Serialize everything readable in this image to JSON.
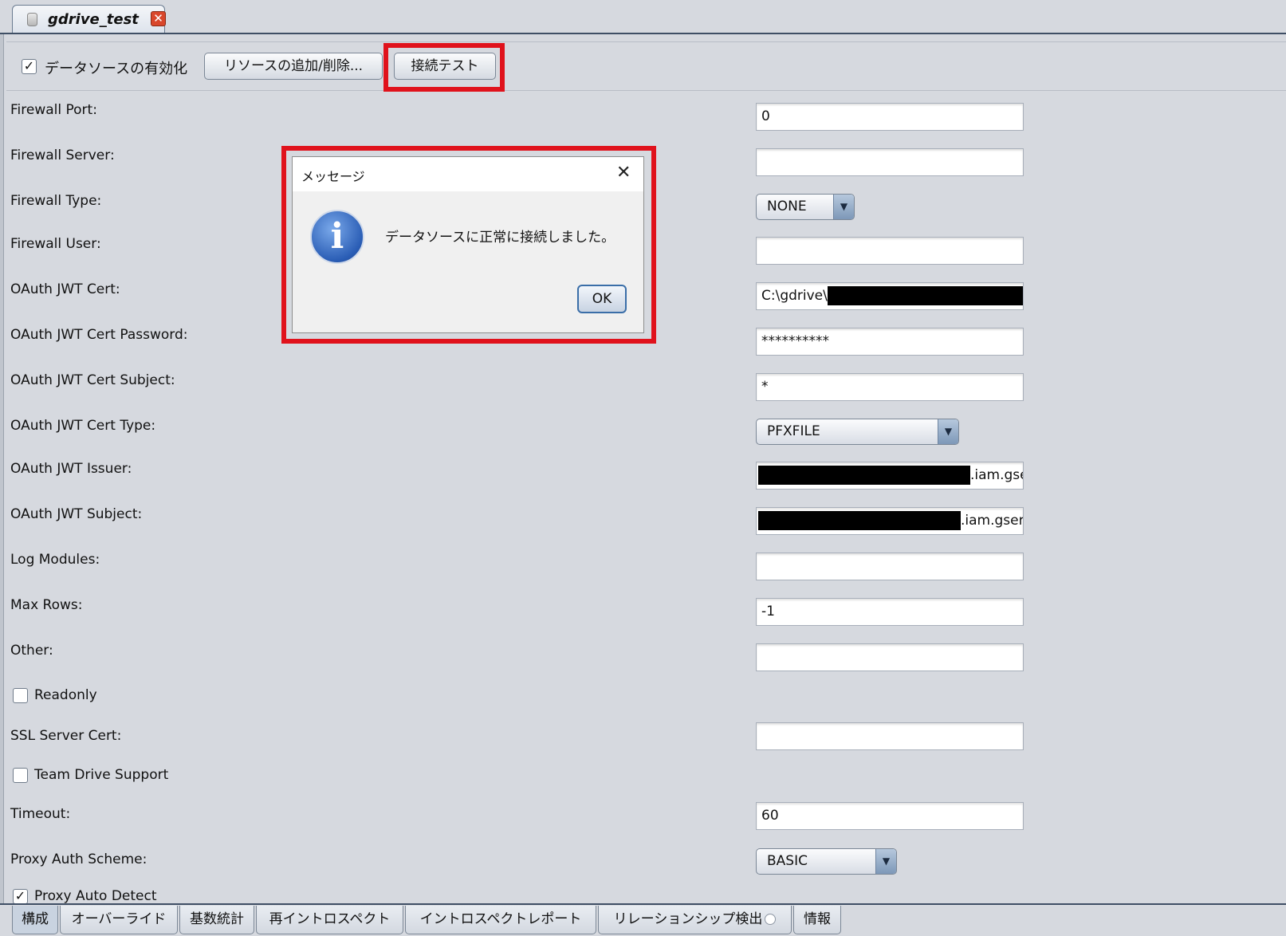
{
  "editor_tab": {
    "title": "gdrive_test",
    "close_glyph": "✕"
  },
  "toolbar": {
    "enable_label": "データソースの有効化",
    "enable_checked": true,
    "add_remove_label": "リソースの追加/削除...",
    "test_label": "接続テスト"
  },
  "form": {
    "firewall_port": {
      "label": "Firewall Port:",
      "value": "0"
    },
    "firewall_server": {
      "label": "Firewall Server:",
      "value": ""
    },
    "firewall_type": {
      "label": "Firewall Type:",
      "value": "NONE"
    },
    "firewall_user": {
      "label": "Firewall User:",
      "value": ""
    },
    "oauth_jwt_cert": {
      "label": "OAuth JWT Cert:",
      "value": "C:\\gdrive\\"
    },
    "oauth_jwt_cert_password": {
      "label": "OAuth JWT Cert Password:",
      "value": "**********"
    },
    "oauth_jwt_cert_subject": {
      "label": "OAuth JWT Cert Subject:",
      "value": "*"
    },
    "oauth_jwt_cert_type": {
      "label": "OAuth JWT Cert Type:",
      "value": "PFXFILE"
    },
    "oauth_jwt_issuer": {
      "label": "OAuth JWT Issuer:",
      "value_suffix": ".iam.gse"
    },
    "oauth_jwt_subject": {
      "label": "OAuth JWT Subject:",
      "value_suffix": ".iam.gser"
    },
    "log_modules": {
      "label": "Log Modules:",
      "value": ""
    },
    "max_rows": {
      "label": "Max Rows:",
      "value": "-1"
    },
    "other": {
      "label": "Other:",
      "value": ""
    },
    "readonly": {
      "label": "Readonly",
      "checked": false
    },
    "ssl_server_cert": {
      "label": "SSL Server Cert:",
      "value": ""
    },
    "team_drive_support": {
      "label": "Team Drive Support",
      "checked": false
    },
    "timeout": {
      "label": "Timeout:",
      "value": "60"
    },
    "proxy_auth_scheme": {
      "label": "Proxy Auth Scheme:",
      "value": "BASIC"
    },
    "proxy_auto_detect": {
      "label": "Proxy Auto Detect",
      "checked": true
    }
  },
  "dialog": {
    "title": "メッセージ",
    "message": "データソースに正常に接続しました。",
    "ok_label": "OK",
    "close_glyph": "✕",
    "icon": "info-icon"
  },
  "bottom_tabs": [
    {
      "label": "構成",
      "active": true
    },
    {
      "label": "オーバーライド"
    },
    {
      "label": "基数統計"
    },
    {
      "label": "再イントロスペクト"
    },
    {
      "label": "イントロスペクトレポート"
    },
    {
      "label": "リレーションシップ検出"
    },
    {
      "label": "情報"
    }
  ],
  "colors": {
    "highlight": "#e0121c",
    "background": "#d6d9df"
  }
}
